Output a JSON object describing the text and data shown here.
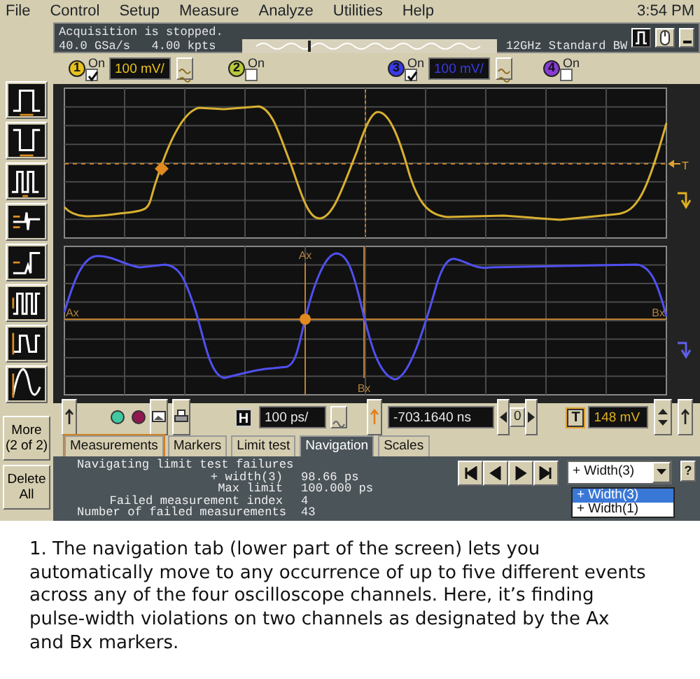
{
  "menu": [
    "File",
    "Control",
    "Setup",
    "Measure",
    "Analyze",
    "Utilities",
    "Help"
  ],
  "clock": "3:54 PM",
  "status": {
    "lines": [
      "Acquisition is stopped.",
      "40.0 GSa/s   4.00 kpts"
    ],
    "bandwidth": "12GHz Standard BW"
  },
  "tools": [
    {
      "kind": "positive_pulse"
    },
    {
      "kind": "negative_pulse"
    },
    {
      "kind": "burst"
    },
    {
      "kind": "rise_glitch"
    },
    {
      "kind": "step_glitch"
    },
    {
      "kind": "pulse_train"
    },
    {
      "kind": "timeout"
    },
    {
      "kind": "sine"
    }
  ],
  "side_buttons": [
    "More\n(2 of 2)",
    "Delete\nAll"
  ],
  "channels": [
    {
      "number": "1",
      "on_label": "On",
      "on": true,
      "scale": "100 mV/",
      "color": "#e8c21c"
    },
    {
      "number": "2",
      "on_label": "On",
      "on": false,
      "color": "#b8c83a"
    },
    {
      "number": "3",
      "on_label": "On",
      "on": true,
      "scale": "100 mV/",
      "color": "#3a3ae8"
    },
    {
      "number": "4",
      "on_label": "On",
      "on": false,
      "color": "#8a3ad8"
    }
  ],
  "scope": {
    "marker_labels": {
      "ax_top": "Ax",
      "ax_left": "Ax",
      "bx_right": "Bx",
      "bx_bottom": "Bx"
    },
    "trigger_marker": "T"
  },
  "controls": {
    "timebase_label": "H",
    "timebase": "100 ps/",
    "position": "-703.1640 ns",
    "step": "0",
    "trigger_label": "T",
    "trigger_level": "148 mV"
  },
  "tabs": [
    {
      "label": "Measurements",
      "selected": false,
      "focused": true
    },
    {
      "label": "Markers",
      "selected": false,
      "focused": false
    },
    {
      "label": "Limit test",
      "selected": false,
      "focused": false
    },
    {
      "label": "Navigation",
      "selected": true,
      "focused": false
    },
    {
      "label": "Scales",
      "selected": false,
      "focused": false
    }
  ],
  "navigation": {
    "title": "Navigating limit test failures",
    "rows": [
      {
        "label": "+ width(3)",
        "value": "98.66 ps"
      },
      {
        "label": "Max limit",
        "value": "100.000 ps"
      },
      {
        "label": "Failed measurement index",
        "value": "4"
      },
      {
        "label": "Number of failed measurements",
        "value": "43"
      }
    ],
    "dropdown": {
      "value": "+ Width(3)",
      "options": [
        {
          "label": "+ Width(3)",
          "selected": true
        },
        {
          "label": "+ Width(1)",
          "selected": false
        }
      ]
    },
    "help": "?"
  },
  "caption": "1. The navigation tab (lower part of the screen) lets you automatically move to any occurrence of up to five different events across any of the four oscilloscope channels. Here, it’s finding pulse-width violations on two channels as designated by the Ax and Bx markers."
}
